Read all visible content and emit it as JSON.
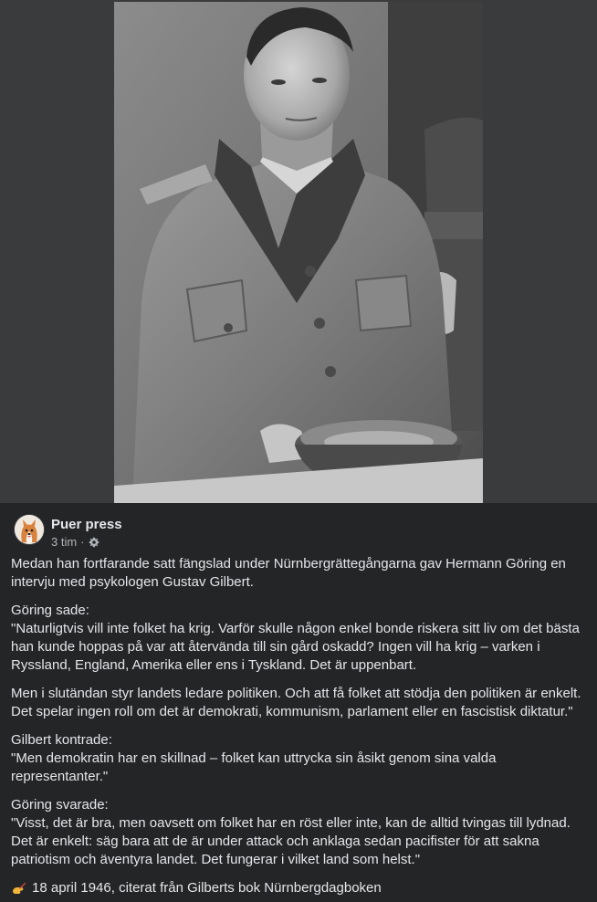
{
  "post": {
    "author": "Puer press",
    "time": "3 tim",
    "separator": "·",
    "icons": {
      "avatar": "corgi-dog-avatar",
      "audience": "gear-icon",
      "footer_emoji": "writing-hand-icon"
    },
    "paragraphs": {
      "intro": "Medan han fortfarande satt fängslad under Nürnbergrättegångarna gav Hermann Göring en intervju med psykologen Gustav Gilbert.",
      "goring_said_label": "Göring sade:",
      "goring_quote_1": "\"Naturligtvis vill inte folket ha krig. Varför skulle någon enkel bonde riskera sitt liv om det bästa han kunde hoppas på var att återvända till sin gård oskadd? Ingen vill ha krig – varken i Ryssland, England, Amerika eller ens i Tyskland. Det är uppenbart.",
      "goring_quote_2": "Men i slutändan styr landets ledare politiken. Och att få folket att stödja den politiken är enkelt. Det spelar ingen roll om det är demokrati, kommunism, parlament eller en fascistisk diktatur.\"",
      "gilbert_label": "Gilbert kontrade:",
      "gilbert_quote": "\"Men demokratin har en skillnad – folket kan uttrycka sin åsikt genom sina valda representanter.\"",
      "goring_replied_label": "Göring svarade:",
      "goring_reply": "\"Visst, det är bra, men oavsett om folket har en röst eller inte, kan de alltid tvingas till lydnad. Det är enkelt: säg bara att de är under attack och anklaga sedan pacifister för att sakna patriotism och äventyra landet. Det fungerar i vilket land som helst.\"",
      "source": "18 april 1946, citerat från Gilberts bok Nürnbergdagboken"
    }
  },
  "colors": {
    "background": "#242526",
    "photo_backdrop": "#3a3b3c",
    "primary_text": "#e4e6eb",
    "secondary_text": "#b0b3b8"
  }
}
